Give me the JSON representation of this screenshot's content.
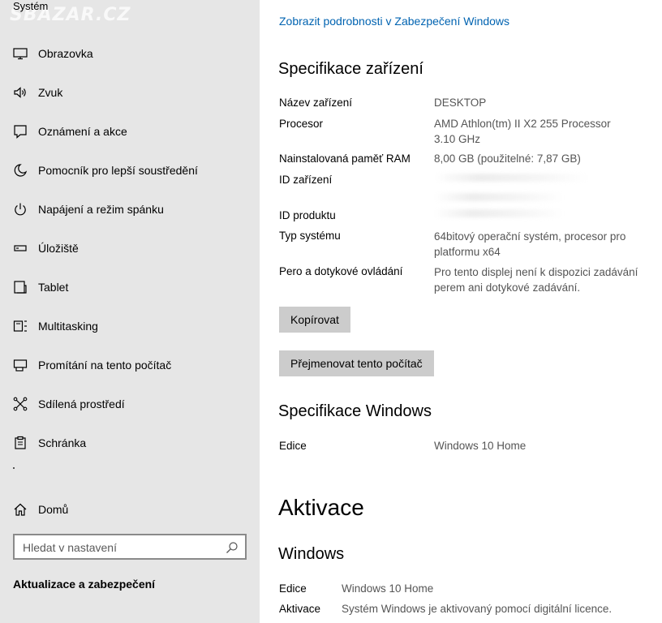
{
  "sidebar": {
    "title": "Systém",
    "watermark": "SBAZAR.CZ",
    "items": [
      {
        "label": "Obrazovka",
        "icon": "monitor-icon"
      },
      {
        "label": "Zvuk",
        "icon": "speaker-icon"
      },
      {
        "label": "Oznámení a akce",
        "icon": "notification-icon"
      },
      {
        "label": "Pomocník pro lepší soustředění",
        "icon": "moon-icon"
      },
      {
        "label": "Napájení a režim spánku",
        "icon": "power-icon"
      },
      {
        "label": "Úložiště",
        "icon": "storage-icon"
      },
      {
        "label": "Tablet",
        "icon": "tablet-icon"
      },
      {
        "label": "Multitasking",
        "icon": "multitasking-icon"
      },
      {
        "label": "Promítání na tento počítač",
        "icon": "projecting-icon"
      },
      {
        "label": "Sdílená prostředí",
        "icon": "shared-experiences-icon"
      },
      {
        "label": "Schránka",
        "icon": "clipboard-icon"
      }
    ],
    "home_label": "Domů",
    "search_placeholder": "Hledat v nastavení",
    "update_label": "Aktualizace a zabezpečení"
  },
  "main": {
    "security_link": "Zobrazit podrobnosti v Zabezpečení Windows",
    "device_specs_title": "Specifikace zařízení",
    "device_specs": [
      {
        "label": "Název zařízení",
        "value": "DESKTOP"
      },
      {
        "label": "Procesor",
        "value": "AMD Athlon(tm) II X2 255 Processor 3.10 GHz"
      },
      {
        "label": "Nainstalovaná paměť RAM",
        "value": "8,00 GB (použitelné: 7,87 GB)"
      },
      {
        "label": "ID zařízení",
        "value": ""
      },
      {
        "label": "ID produktu",
        "value": ""
      },
      {
        "label": "Typ systému",
        "value": "64bitový operační systém, procesor pro platformu x64"
      },
      {
        "label": "Pero a dotykové ovládání",
        "value": "Pro tento displej není k dispozici zadávání perem ani dotykové zadávání."
      }
    ],
    "copy_button": "Kopírovat",
    "rename_button": "Přejmenovat tento počítač",
    "windows_specs_title": "Specifikace Windows",
    "windows_specs": [
      {
        "label": "Edice",
        "value": "Windows 10 Home"
      }
    ],
    "activation_title": "Aktivace",
    "activation_subtitle": "Windows",
    "activation": [
      {
        "label": "Edice",
        "value": "Windows 10 Home"
      },
      {
        "label": "Aktivace",
        "value": "Systém Windows je aktivovaný pomocí digitální licence."
      }
    ]
  },
  "colors": {
    "sidebar_bg": "#e6e6e6",
    "link": "#0063b1",
    "button_bg": "#cccccc",
    "value_text": "#555555"
  }
}
